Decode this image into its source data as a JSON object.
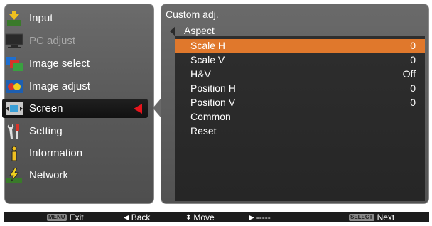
{
  "sidebar": {
    "items": [
      {
        "label": "Input",
        "icon": "input-icon"
      },
      {
        "label": "PC adjust",
        "icon": "pc-adjust-icon"
      },
      {
        "label": "Image select",
        "icon": "image-select-icon"
      },
      {
        "label": "Image adjust",
        "icon": "image-adjust-icon"
      },
      {
        "label": "Screen",
        "icon": "screen-icon"
      },
      {
        "label": "Setting",
        "icon": "setting-icon"
      },
      {
        "label": "Information",
        "icon": "information-icon"
      },
      {
        "label": "Network",
        "icon": "network-icon"
      }
    ],
    "selected": "Screen",
    "disabled": [
      "PC adjust"
    ]
  },
  "panel": {
    "title": "Custom adj.",
    "back_tab": "Aspect",
    "rows": [
      {
        "label": "Scale H",
        "value": "0"
      },
      {
        "label": "Scale V",
        "value": "0"
      },
      {
        "label": "H&V",
        "value": "Off"
      },
      {
        "label": "Position H",
        "value": "0"
      },
      {
        "label": "Position V",
        "value": "0"
      },
      {
        "label": "Common",
        "value": ""
      },
      {
        "label": "Reset",
        "value": ""
      }
    ],
    "highlighted_row": "Scale H"
  },
  "footer": {
    "menu_key": "MENU",
    "exit": "Exit",
    "back": "Back",
    "move": "Move",
    "right": "-----",
    "select_key": "SELECT",
    "next": "Next"
  },
  "colors": {
    "highlight": "#e0782c",
    "selector_arrow": "#e8141c",
    "panel_bg": "#5e5e5e",
    "inner_bg": "#2a2a2a",
    "footer_bg": "#1c1c1c"
  }
}
